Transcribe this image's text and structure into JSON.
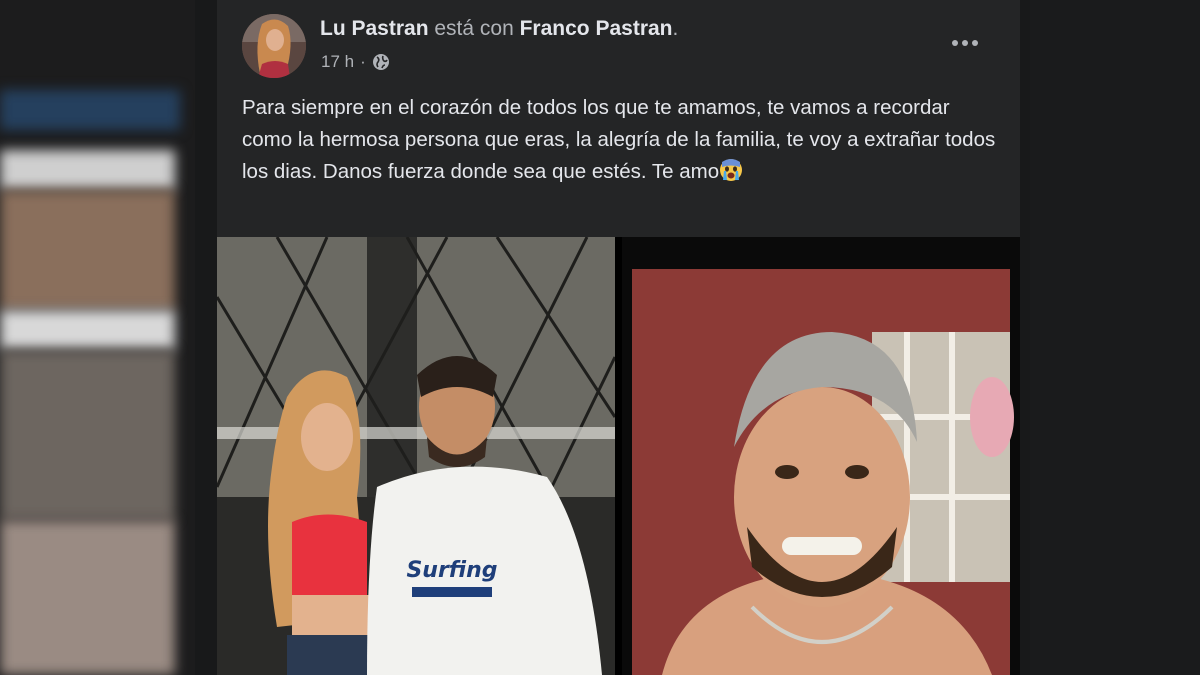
{
  "post": {
    "author": "Lu Pastran",
    "with_text": "está con",
    "tagged": "Franco Pastran",
    "tagged_suffix": ".",
    "timestamp": "17 h",
    "separator": "·",
    "privacy_icon": "globe-icon",
    "more_icon": "more-options-icon",
    "text": "Para siempre en el corazón de todos los que te amamos, te vamos a recordar como la hermosa persona que eras, la alegría de la familia, te voy a extrañar todos los dias. Danos fuerza donde sea que estés. Te amo",
    "emoji": "crying-face-emoji"
  },
  "colors": {
    "page_background": "#18191a",
    "card_background": "#242526",
    "primary_text": "#e4e6eb",
    "secondary_text": "#b0b3b8"
  }
}
